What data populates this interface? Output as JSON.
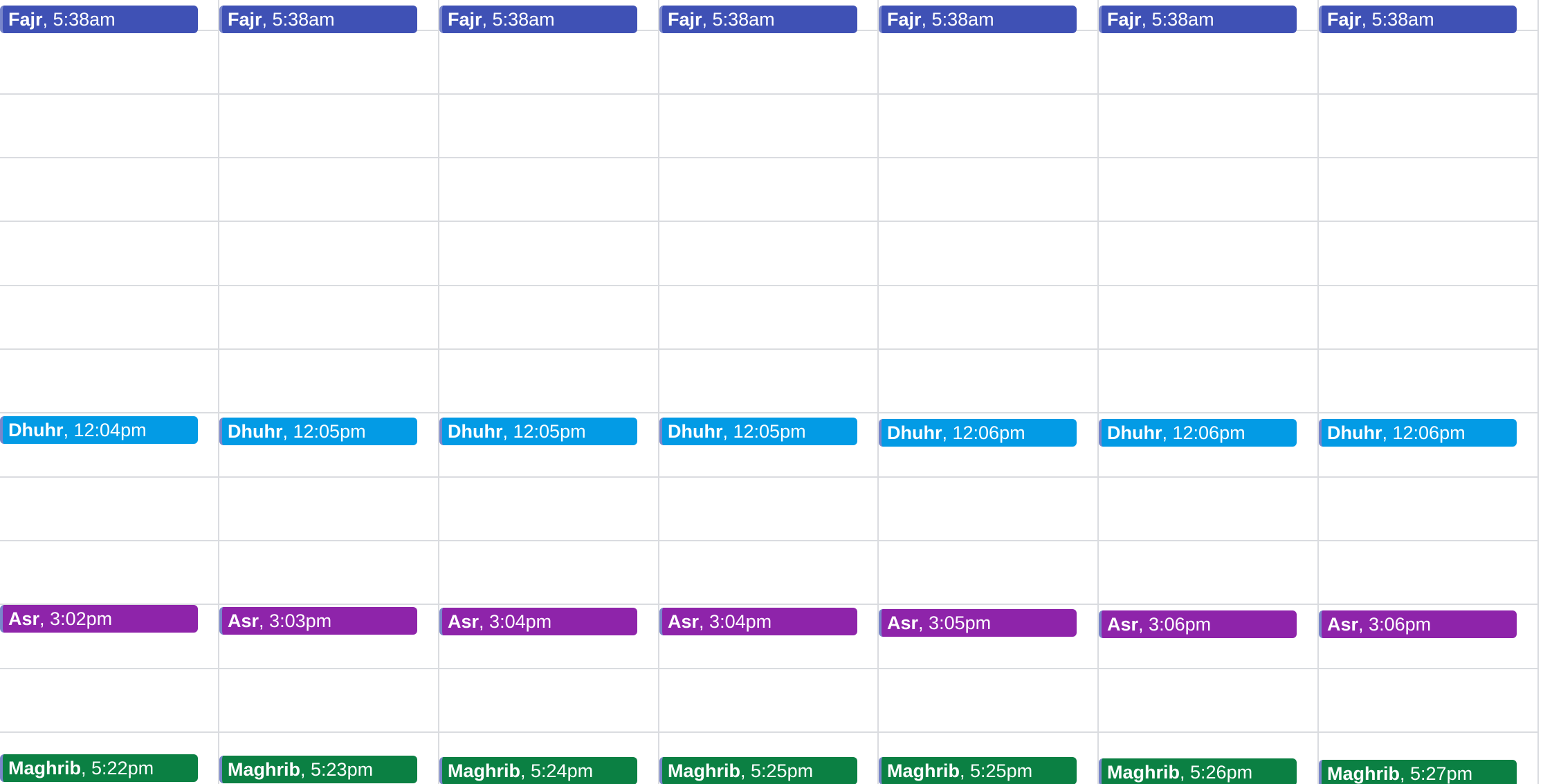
{
  "colors": {
    "fajr": "#3f51b5",
    "dhuhr": "#039be5",
    "asr": "#8e24aa",
    "maghrib": "#0b8043",
    "grid": "#dadce0",
    "event_edge": "#7986cb"
  },
  "days": [
    {
      "events": [
        {
          "title": "Fajr",
          "time": "5:38am"
        },
        {
          "title": "Dhuhr",
          "time": "12:04pm"
        },
        {
          "title": "Asr",
          "time": "3:02pm"
        },
        {
          "title": "Maghrib",
          "time": "5:22pm"
        }
      ]
    },
    {
      "events": [
        {
          "title": "Fajr",
          "time": "5:38am"
        },
        {
          "title": "Dhuhr",
          "time": "12:05pm"
        },
        {
          "title": "Asr",
          "time": "3:03pm"
        },
        {
          "title": "Maghrib",
          "time": "5:23pm"
        }
      ]
    },
    {
      "events": [
        {
          "title": "Fajr",
          "time": "5:38am"
        },
        {
          "title": "Dhuhr",
          "time": "12:05pm"
        },
        {
          "title": "Asr",
          "time": "3:04pm"
        },
        {
          "title": "Maghrib",
          "time": "5:24pm"
        }
      ]
    },
    {
      "events": [
        {
          "title": "Fajr",
          "time": "5:38am"
        },
        {
          "title": "Dhuhr",
          "time": "12:05pm"
        },
        {
          "title": "Asr",
          "time": "3:04pm"
        },
        {
          "title": "Maghrib",
          "time": "5:25pm"
        }
      ]
    },
    {
      "events": [
        {
          "title": "Fajr",
          "time": "5:38am"
        },
        {
          "title": "Dhuhr",
          "time": "12:06pm"
        },
        {
          "title": "Asr",
          "time": "3:05pm"
        },
        {
          "title": "Maghrib",
          "time": "5:25pm"
        }
      ]
    },
    {
      "events": [
        {
          "title": "Fajr",
          "time": "5:38am"
        },
        {
          "title": "Dhuhr",
          "time": "12:06pm"
        },
        {
          "title": "Asr",
          "time": "3:06pm"
        },
        {
          "title": "Maghrib",
          "time": "5:26pm"
        }
      ]
    },
    {
      "events": [
        {
          "title": "Fajr",
          "time": "5:38am"
        },
        {
          "title": "Dhuhr",
          "time": "12:06pm"
        },
        {
          "title": "Asr",
          "time": "3:06pm"
        },
        {
          "title": "Maghrib",
          "time": "5:27pm"
        }
      ]
    }
  ]
}
